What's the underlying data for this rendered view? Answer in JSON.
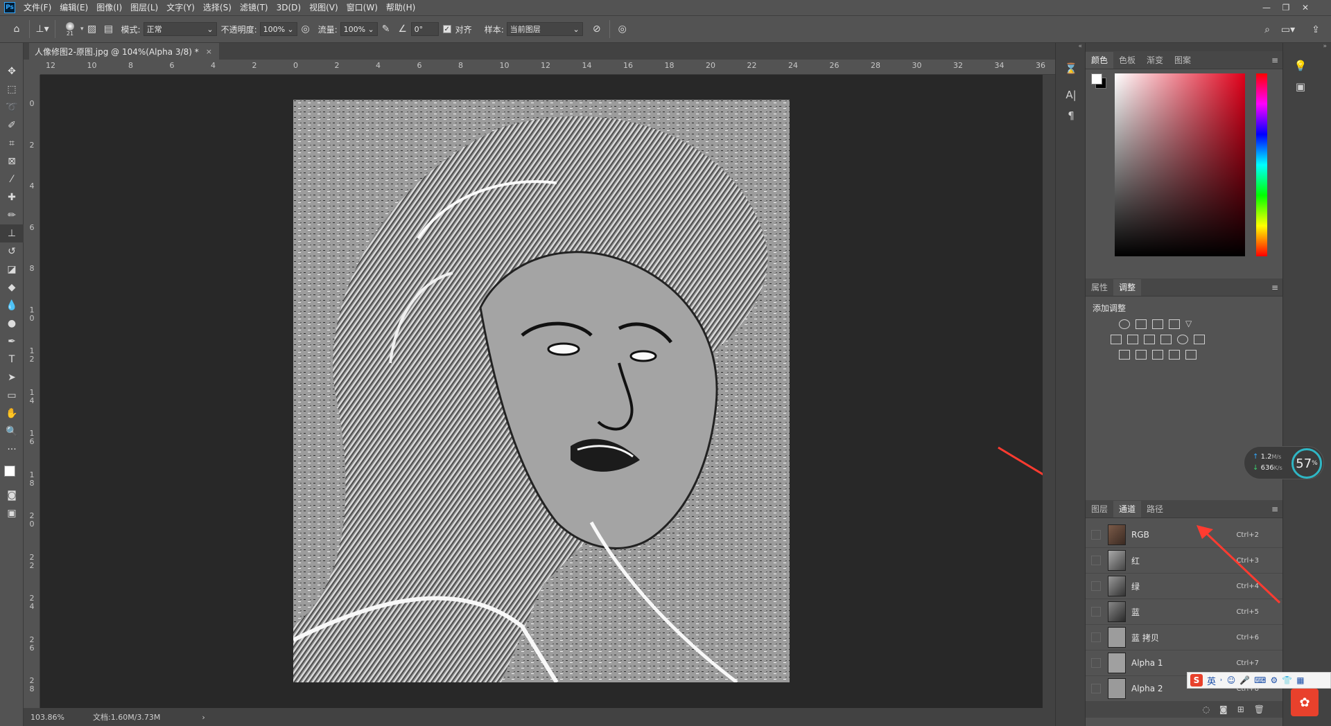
{
  "app": {
    "logo": "Ps"
  },
  "menubar": {
    "items": [
      "文件(F)",
      "编辑(E)",
      "图像(I)",
      "图层(L)",
      "文字(Y)",
      "选择(S)",
      "滤镜(T)",
      "3D(D)",
      "视图(V)",
      "窗口(W)",
      "帮助(H)"
    ]
  },
  "window_controls": {
    "minimize": "—",
    "restore": "❐",
    "close": "✕"
  },
  "options": {
    "brush_size": "21",
    "mode_label": "模式:",
    "mode_value": "正常",
    "opacity_label": "不透明度:",
    "opacity_value": "100%",
    "flow_label": "流量:",
    "flow_value": "100%",
    "angle_value": "0°",
    "aligned_label": "对齐",
    "sample_label": "样本:",
    "sample_value": "当前图层"
  },
  "document": {
    "tab_title": "人像修图2-原图.jpg @ 104%(Alpha 3/8) *",
    "close": "×"
  },
  "ruler_top": [
    "12",
    "10",
    "8",
    "6",
    "4",
    "2",
    "0",
    "2",
    "4",
    "6",
    "8",
    "10",
    "12",
    "14",
    "16",
    "18",
    "20",
    "22",
    "24",
    "26",
    "28",
    "30",
    "32",
    "34",
    "36"
  ],
  "ruler_left": [
    "0",
    "2",
    "4",
    "6",
    "8",
    "1 0",
    "1 2",
    "1 4",
    "1 6",
    "1 8",
    "2 0",
    "2 2",
    "2 4",
    "2 6",
    "2 8"
  ],
  "status": {
    "zoom": "103.86%",
    "doc_info": "文档:1.60M/3.73M",
    "arrow": "›"
  },
  "color_panel": {
    "tabs": [
      "颜色",
      "色板",
      "渐变",
      "图案"
    ],
    "active": 0
  },
  "adjust_panel": {
    "tabs": [
      "属性",
      "调整"
    ],
    "active": 1,
    "title": "添加调整"
  },
  "channels_panel": {
    "tabs": [
      "图层",
      "通道",
      "路径"
    ],
    "active": 1,
    "channels": [
      {
        "name": "RGB",
        "shortcut": "Ctrl+2"
      },
      {
        "name": "红",
        "shortcut": "Ctrl+3"
      },
      {
        "name": "绿",
        "shortcut": "Ctrl+4"
      },
      {
        "name": "蓝",
        "shortcut": "Ctrl+5"
      },
      {
        "name": "蓝 拷贝",
        "shortcut": "Ctrl+6"
      },
      {
        "name": "Alpha 1",
        "shortcut": "Ctrl+7"
      },
      {
        "name": "Alpha 2",
        "shortcut": "Ctrl+8"
      }
    ]
  },
  "net_widget": {
    "up": "1.2",
    "up_unit": "M/s",
    "down": "636",
    "down_unit": "K/s",
    "percent": "57",
    "percent_sign": "%"
  },
  "ime_bar": {
    "logo": "S",
    "lang": "英"
  },
  "colors": {
    "menubar": "#535353",
    "canvas": "#282828",
    "accent": "#31a8ff",
    "annotation_arrow": "#ff3b30"
  }
}
